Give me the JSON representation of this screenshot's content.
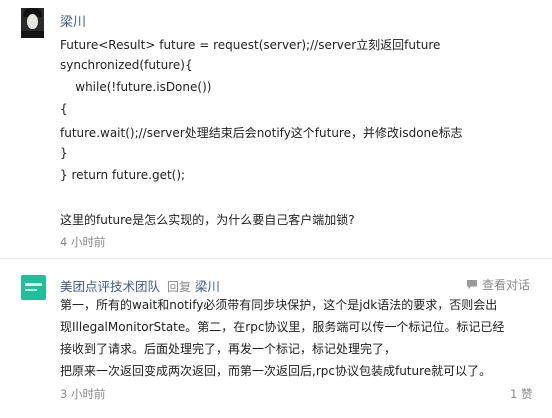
{
  "comment1": {
    "author": "梁川",
    "lines": [
      "Future<Result> future = request(server);//server立刻返回future",
      "synchronized(future){",
      "    while(!future.isDone())",
      "{",
      "future.wait();//server处理结束后会notify这个future，并修改isdone标志",
      "}",
      "} return future.get();",
      "",
      "这里的future是怎么实现的，为什么要自己客户端加锁?"
    ],
    "time": "4 小时前"
  },
  "comment2": {
    "author": "美团点评技术团队",
    "reply_word": "回复",
    "reply_to": "梁川",
    "view_conversation": "查看对话",
    "lines": [
      "第一，所有的wait和notify必须带有同步块保护，这个是jdk语法的要求，否则会出",
      "现IllegalMonitorState。第二，在rpc协议里，服务端可以传一个标记位。标记已经",
      "接收到了请求。后面处理完了，再发一个标记，标记处理完了，",
      "把原来一次返回变成两次返回，而第一次返回后,rpc协议包装成future就可以了。"
    ],
    "time": "3 小时前",
    "likes": "1 赞"
  },
  "icons": {
    "chat": "chat-bubble-icon"
  },
  "colors": {
    "author": "#405c8c",
    "meta": "#8a8a8a",
    "avatar_team": "#1fbf9a"
  }
}
